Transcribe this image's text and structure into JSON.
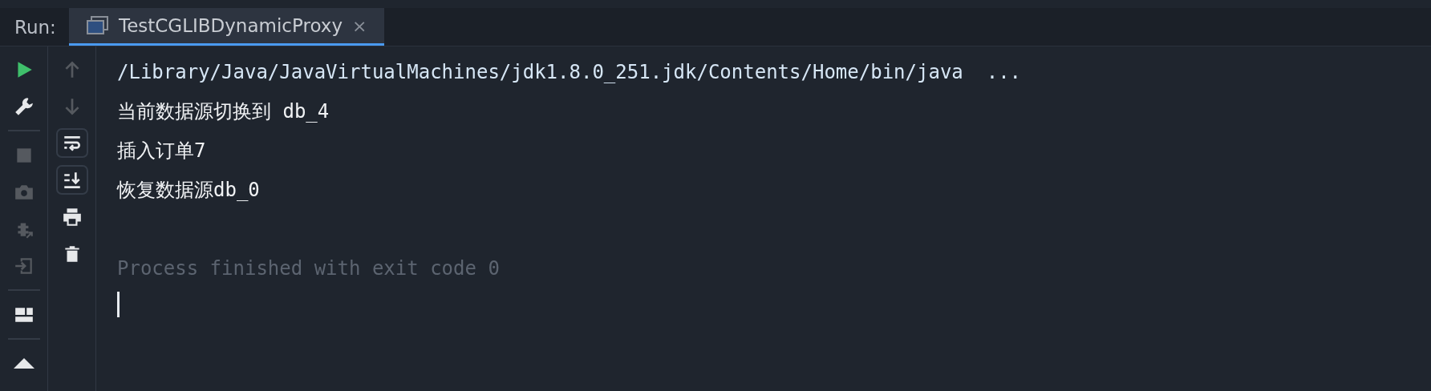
{
  "run_panel": {
    "label": "Run:",
    "tabs": [
      {
        "title": "TestCGLIBDynamicProxy",
        "selected": true,
        "close": "×"
      }
    ]
  },
  "left_toolbar": [
    {
      "kind": "run",
      "disabled": false
    },
    {
      "kind": "settings",
      "disabled": false
    },
    {
      "kind": "separator"
    },
    {
      "kind": "stop",
      "disabled": true
    },
    {
      "kind": "camera",
      "disabled": true
    },
    {
      "kind": "debug-export",
      "disabled": true
    },
    {
      "kind": "exit",
      "disabled": true
    },
    {
      "kind": "separator"
    },
    {
      "kind": "layout",
      "disabled": false
    },
    {
      "kind": "separator"
    },
    {
      "kind": "pin",
      "disabled": false
    }
  ],
  "console_toolbar": [
    {
      "kind": "up",
      "disabled": true,
      "on": false
    },
    {
      "kind": "down",
      "disabled": true,
      "on": false
    },
    {
      "kind": "wrap",
      "disabled": false,
      "on": true
    },
    {
      "kind": "scroll-end",
      "disabled": false,
      "on": true
    },
    {
      "kind": "print",
      "disabled": false,
      "on": false
    },
    {
      "kind": "trash",
      "disabled": false,
      "on": false
    }
  ],
  "console": {
    "lines": [
      {
        "kind": "command",
        "text": "/Library/Java/JavaVirtualMachines/jdk1.8.0_251.jdk/Contents/Home/bin/java  ..."
      },
      {
        "kind": "output",
        "text": "当前数据源切换到 db_4"
      },
      {
        "kind": "output",
        "text": "插入订单7"
      },
      {
        "kind": "output",
        "text": "恢复数据源db_0"
      },
      {
        "kind": "blank"
      },
      {
        "kind": "system",
        "text": "Process finished with exit code 0"
      }
    ],
    "cursor": true
  }
}
